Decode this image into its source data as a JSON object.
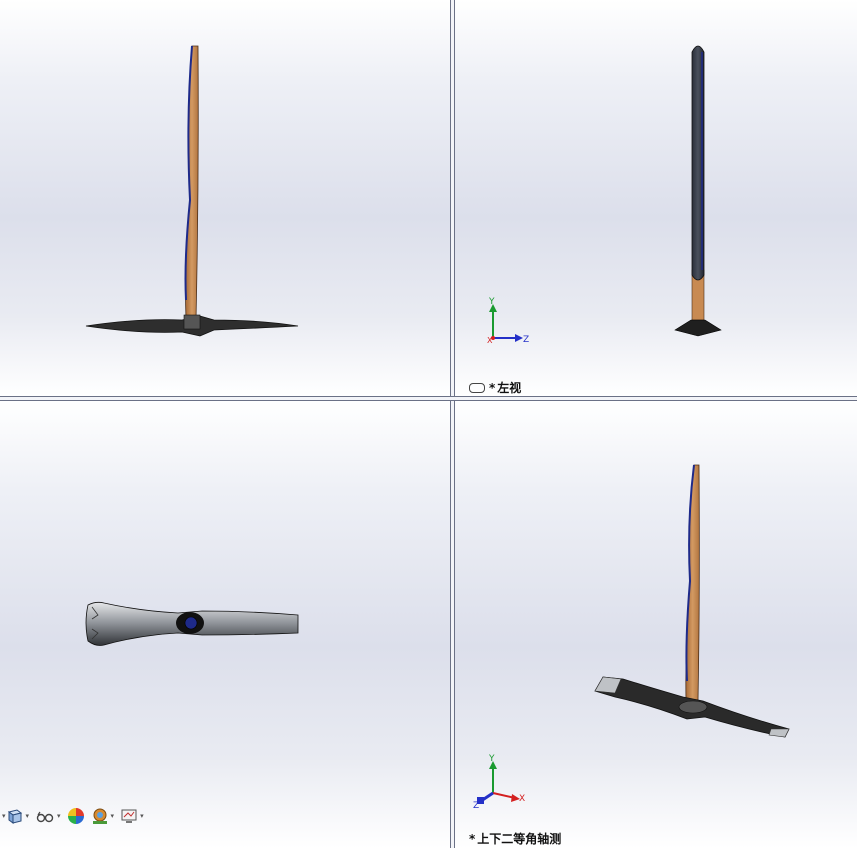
{
  "viewports": {
    "top_right": {
      "label_prefix": "*",
      "label": "左视",
      "triad": {
        "y": "Y",
        "z": "Z",
        "x": "X"
      }
    },
    "bottom_right": {
      "label_prefix": "*",
      "label": "上下二等角轴测",
      "triad": {
        "y": "Y",
        "x": "X",
        "z": "Z"
      }
    }
  },
  "toolbar": {
    "items": [
      {
        "icon": "view-cube-icon"
      },
      {
        "icon": "glasses-icon"
      },
      {
        "icon": "appearance-sphere-icon"
      },
      {
        "icon": "scene-icon"
      },
      {
        "icon": "display-settings-icon"
      }
    ]
  },
  "colors": {
    "handle": "#c88a52",
    "head": "#3a3a3a",
    "axis_x": "#d42020",
    "axis_y": "#1a9a30",
    "axis_z": "#2430c8",
    "accent_blue": "#1e2a8a"
  }
}
